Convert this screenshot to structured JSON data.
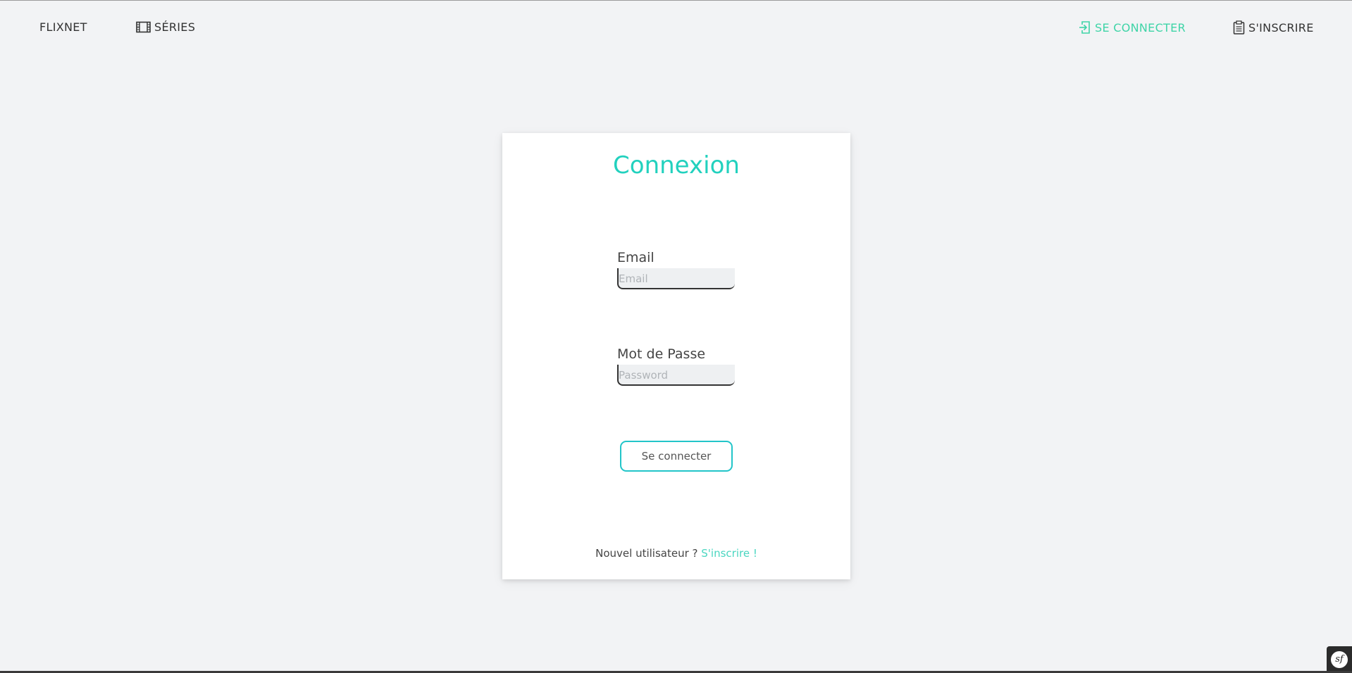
{
  "nav": {
    "brand": "FLIXNET",
    "series_label": "SÉRIES",
    "series_icon": "film-icon",
    "login_label": "SE CONNECTER",
    "login_icon": "sign-in-icon",
    "register_label": "S'INSCRIRE",
    "register_icon": "clipboard-icon"
  },
  "login_form": {
    "title": "Connexion",
    "email_label": "Email",
    "email_placeholder": "Email",
    "email_value": "",
    "password_label": "Mot de Passe",
    "password_placeholder": "Password",
    "password_value": "",
    "submit_label": "Se connecter",
    "footer_prefix": "Nouvel utilisateur ? ",
    "footer_link": "S'inscrire !"
  },
  "colors": {
    "accent": "#22d1be",
    "login_nav": "#3fd4a7",
    "background": "#f2f3f5",
    "button_border": "#22c5c9"
  },
  "debug_toolbar": {
    "icon": "symfony-icon",
    "label": "sf"
  }
}
